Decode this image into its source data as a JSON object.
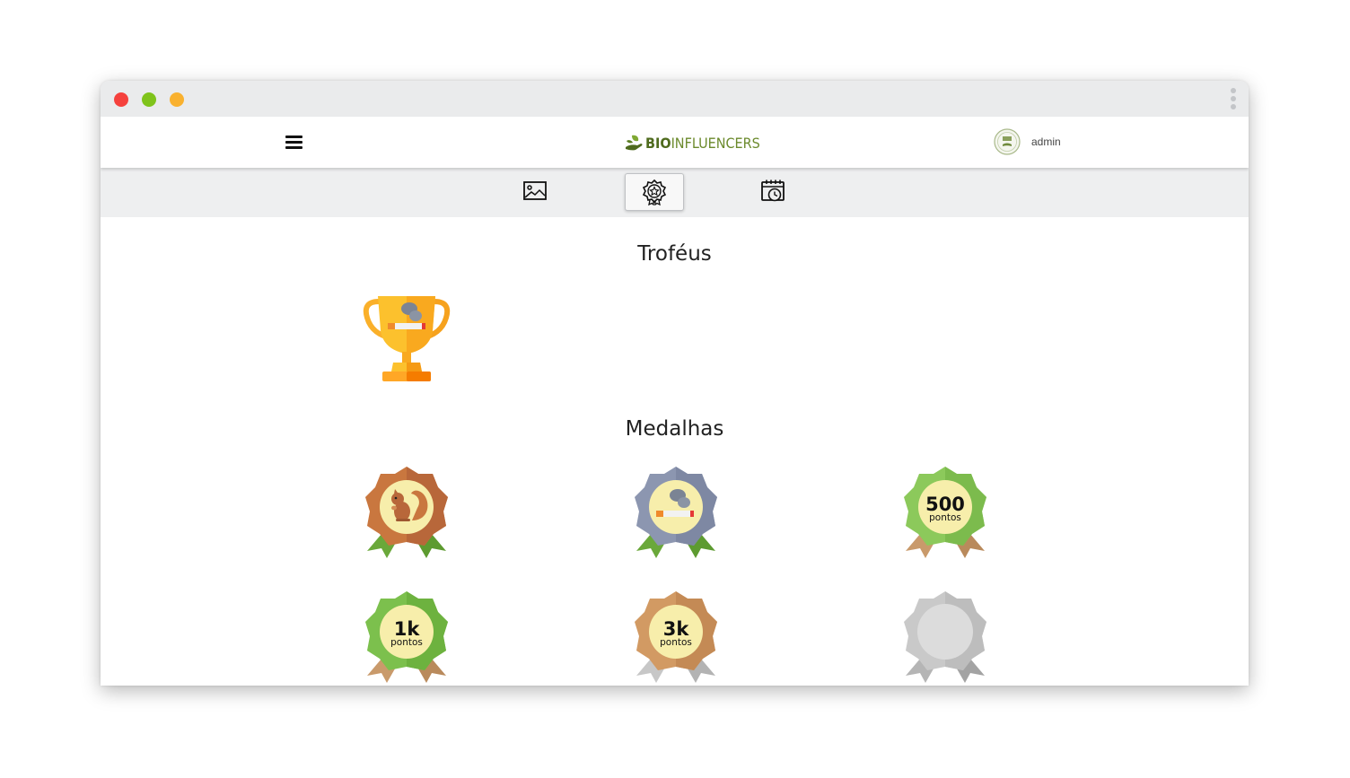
{
  "app": {
    "logo_bio": "BIO",
    "logo_rest": "INFLUENCERS"
  },
  "user": {
    "name": "admin"
  },
  "tabs": [
    {
      "icon": "image-icon"
    },
    {
      "icon": "award-icon",
      "active": true
    },
    {
      "icon": "calendar-clock-icon"
    }
  ],
  "trophies": {
    "title": "Troféus",
    "items": [
      {
        "icon": "trophy-cigarette-icon"
      }
    ]
  },
  "medals": {
    "title": "Medalhas",
    "items": [
      {
        "icon": "squirrel-medal-icon"
      },
      {
        "icon": "cigarette-medal-icon"
      },
      {
        "icon": "points-medal-icon",
        "value": "500",
        "unit": "pontos"
      },
      {
        "icon": "points-medal-icon",
        "value": "1k",
        "unit": "pontos"
      },
      {
        "icon": "points-medal-icon",
        "value": "3k",
        "unit": "pontos"
      },
      {
        "icon": "locked-medal-icon"
      }
    ]
  },
  "colors": {
    "green_medal": "#8cc95b",
    "brown_medal": "#c47a4d",
    "gray_medal": "#8c96b0",
    "medal_center": "#f7eeab",
    "trophy_gold": "#fcc12d",
    "locked": "#c9c9c9"
  }
}
